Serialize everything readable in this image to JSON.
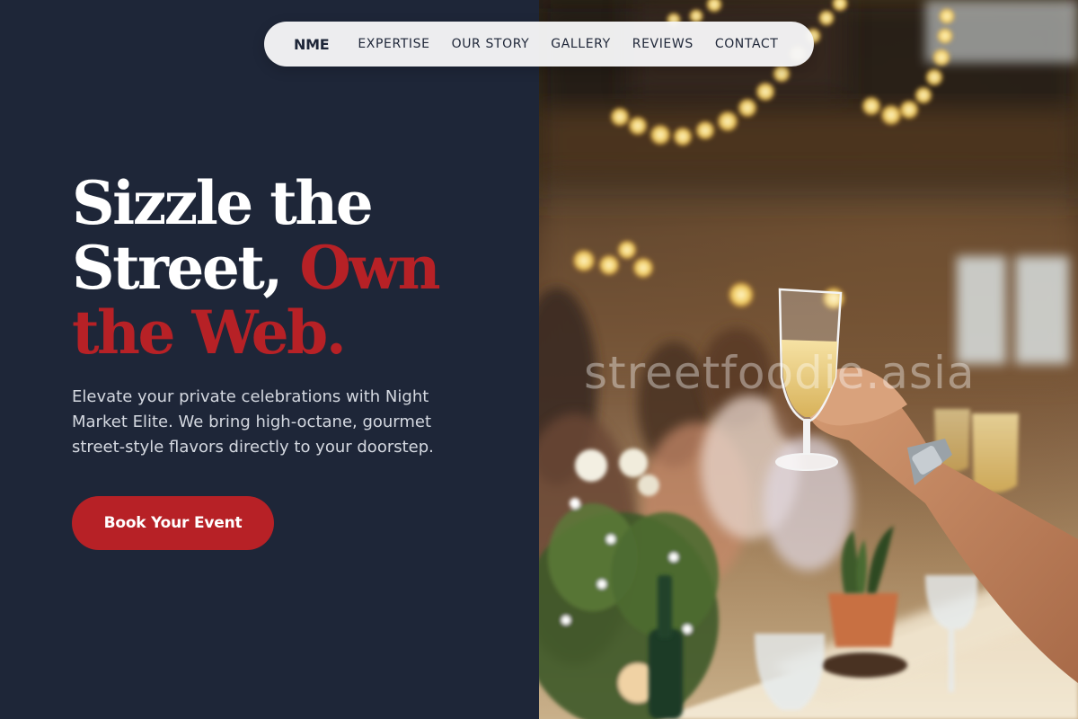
{
  "nav": {
    "logo": "NME",
    "links": [
      "EXPERTISE",
      "OUR STORY",
      "GALLERY",
      "REVIEWS",
      "CONTACT"
    ]
  },
  "hero": {
    "headline_line1": "Sizzle the",
    "headline_line2_white": "Street,",
    "headline_line2_red": "Own",
    "headline_line3_red": "the Web.",
    "subtext": "Elevate your private celebrations with Night Market Elite. We bring high-octane, gourmet street-style flavors directly to your doorstep.",
    "cta_label": "Book Your Event"
  },
  "image": {
    "watermark": "streetfoodie.asia"
  },
  "colors": {
    "background": "#1e2638",
    "accent": "#b72126",
    "nav_background": "#f6f6f7",
    "body_text": "#d4d8e0"
  },
  "icons": []
}
